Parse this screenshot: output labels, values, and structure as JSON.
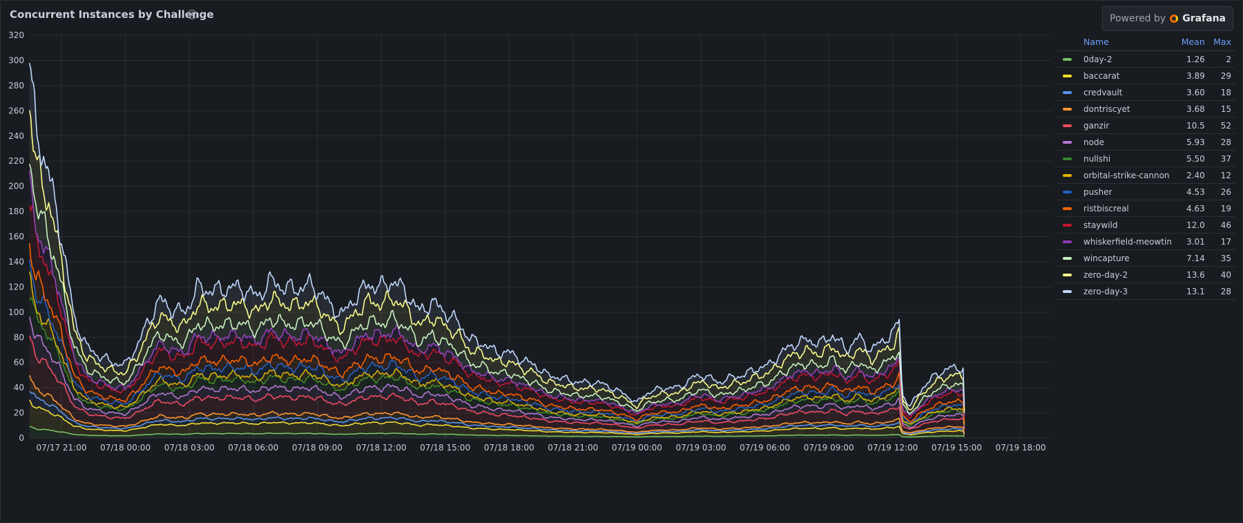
{
  "panel": {
    "title": "Concurrent Instances by Challenge",
    "powered_by": "Powered by",
    "brand": "Grafana"
  },
  "legend": {
    "headers": [
      "Name",
      "Mean",
      "Max"
    ]
  },
  "chart_data": {
    "type": "area",
    "stacked": true,
    "x_ticks": [
      "07/17 21:00",
      "07/18 00:00",
      "07/18 03:00",
      "07/18 06:00",
      "07/18 09:00",
      "07/18 12:00",
      "07/18 15:00",
      "07/18 18:00",
      "07/18 21:00",
      "07/19 00:00",
      "07/19 03:00",
      "07/19 06:00",
      "07/19 09:00",
      "07/19 12:00",
      "07/19 15:00",
      "07/19 18:00"
    ],
    "ylim": [
      0,
      320
    ],
    "y_ticks": [
      0,
      20,
      40,
      60,
      80,
      100,
      120,
      140,
      160,
      180,
      200,
      220,
      240,
      260,
      280,
      300,
      320
    ],
    "grid": true,
    "legend_position": "right",
    "total_profile": [
      [
        -1.5,
        298
      ],
      [
        -1.2,
        245
      ],
      [
        -0.6,
        210
      ],
      [
        0,
        160
      ],
      [
        0.6,
        95
      ],
      [
        1.2,
        72
      ],
      [
        1.8,
        65
      ],
      [
        2.4,
        60
      ],
      [
        3,
        58
      ],
      [
        3.6,
        75
      ],
      [
        4,
        90
      ],
      [
        4.6,
        110
      ],
      [
        5.2,
        102
      ],
      [
        5.8,
        100
      ],
      [
        6.4,
        120
      ],
      [
        7,
        117
      ],
      [
        7.6,
        118
      ],
      [
        8,
        120
      ],
      [
        8.6,
        118
      ],
      [
        9.2,
        112
      ],
      [
        9.8,
        125
      ],
      [
        10.4,
        120
      ],
      [
        11,
        118
      ],
      [
        11.6,
        122
      ],
      [
        12.2,
        115
      ],
      [
        12.6,
        105
      ],
      [
        13.2,
        98
      ],
      [
        13.8,
        112
      ],
      [
        14.4,
        122
      ],
      [
        15,
        120
      ],
      [
        15.6,
        125
      ],
      [
        16.2,
        115
      ],
      [
        16.8,
        100
      ],
      [
        17.4,
        108
      ],
      [
        18,
        100
      ],
      [
        18.6,
        92
      ],
      [
        19.2,
        78
      ],
      [
        19.8,
        75
      ],
      [
        20.4,
        68
      ],
      [
        21,
        68
      ],
      [
        21.6,
        62
      ],
      [
        22.2,
        58
      ],
      [
        22.8,
        50
      ],
      [
        23.4,
        48
      ],
      [
        24,
        45
      ],
      [
        24.6,
        44
      ],
      [
        25.2,
        44
      ],
      [
        25.8,
        40
      ],
      [
        26.4,
        35
      ],
      [
        27,
        28
      ],
      [
        27.4,
        35
      ],
      [
        27.8,
        38
      ],
      [
        28.4,
        40
      ],
      [
        29,
        40
      ],
      [
        29.6,
        48
      ],
      [
        30.2,
        50
      ],
      [
        30.8,
        44
      ],
      [
        31.4,
        48
      ],
      [
        32,
        50
      ],
      [
        32.6,
        55
      ],
      [
        33.2,
        58
      ],
      [
        33.8,
        68
      ],
      [
        34.4,
        75
      ],
      [
        35,
        78
      ],
      [
        35.6,
        75
      ],
      [
        36.2,
        82
      ],
      [
        36.8,
        70
      ],
      [
        37.4,
        80
      ],
      [
        38,
        70
      ],
      [
        38.6,
        78
      ],
      [
        39.1,
        85
      ],
      [
        39.3,
        95
      ],
      [
        39.45,
        35
      ],
      [
        39.8,
        25
      ],
      [
        40.4,
        40
      ],
      [
        41,
        50
      ],
      [
        41.6,
        55
      ],
      [
        42,
        56
      ],
      [
        42.3,
        55
      ],
      [
        42.4,
        5
      ]
    ],
    "series": [
      {
        "name": "0day-2",
        "color": "#73bf69",
        "mean": "1.26",
        "max": "2",
        "frac": 0.03
      },
      {
        "name": "baccarat",
        "color": "#fade2a",
        "mean": "3.89",
        "max": "29",
        "frac": 0.1
      },
      {
        "name": "credvault",
        "color": "#5794f2",
        "mean": "3.60",
        "max": "18",
        "frac": 0.13
      },
      {
        "name": "dontriscyet",
        "color": "#ff9830",
        "mean": "3.68",
        "max": "15",
        "frac": 0.16
      },
      {
        "name": "ganzir",
        "color": "#f2495c",
        "mean": "10.5",
        "max": "52",
        "frac": 0.27
      },
      {
        "name": "node",
        "color": "#b877d9",
        "mean": "5.93",
        "max": "28",
        "frac": 0.33
      },
      {
        "name": "nullshi",
        "color": "#37872d",
        "mean": "5.50",
        "max": "37",
        "frac": 0.39
      },
      {
        "name": "orbital-strike-cannon",
        "color": "#e0b400",
        "mean": "2.40",
        "max": "12",
        "frac": 0.42
      },
      {
        "name": "pusher",
        "color": "#1f60c4",
        "mean": "4.53",
        "max": "26",
        "frac": 0.47
      },
      {
        "name": "ristbiscreal",
        "color": "#fa6400",
        "mean": "4.63",
        "max": "19",
        "frac": 0.52
      },
      {
        "name": "staywild",
        "color": "#c4162a",
        "mean": "12.0",
        "max": "46",
        "frac": 0.64
      },
      {
        "name": "whiskerfield-meowtin",
        "color": "#8f3bb8",
        "mean": "3.01",
        "max": "17",
        "frac": 0.68
      },
      {
        "name": "wincapture",
        "color": "#c8f2c2",
        "mean": "7.14",
        "max": "35",
        "frac": 0.76
      },
      {
        "name": "zero-day-2",
        "color": "#ffff87",
        "mean": "13.6",
        "max": "40",
        "frac": 0.89
      },
      {
        "name": "zero-day-3",
        "color": "#c0d8ff",
        "mean": "13.1",
        "max": "28",
        "frac": 1.0
      }
    ]
  }
}
